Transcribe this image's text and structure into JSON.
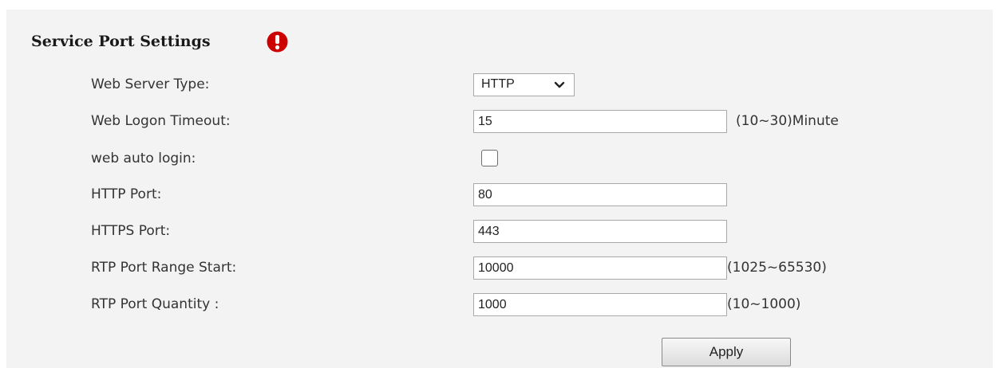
{
  "section": {
    "title": "Service Port Settings",
    "alert_icon": "exclamation-circle-icon",
    "alert_color": "#cc0000"
  },
  "fields": {
    "web_server_type": {
      "label": "Web Server Type:",
      "value": "HTTP",
      "icon": "chevron-down-icon"
    },
    "web_logon_timeout": {
      "label": "Web Logon Timeout:",
      "value": "15",
      "hint": "(10~30)Minute"
    },
    "web_auto_login": {
      "label": "web auto login:",
      "checked": false
    },
    "http_port": {
      "label": "HTTP Port:",
      "value": "80"
    },
    "https_port": {
      "label": "HTTPS Port:",
      "value": "443"
    },
    "rtp_port_range_start": {
      "label": "RTP Port Range Start:",
      "value": "10000",
      "hint": "(1025~65530)"
    },
    "rtp_port_quantity": {
      "label": "RTP Port Quantity :",
      "value": "1000",
      "hint": "(10~1000)"
    }
  },
  "actions": {
    "apply_label": "Apply"
  },
  "colors": {
    "panel_background": "#f3f3f3",
    "input_border": "#a9a9a9",
    "text": "#333333"
  }
}
